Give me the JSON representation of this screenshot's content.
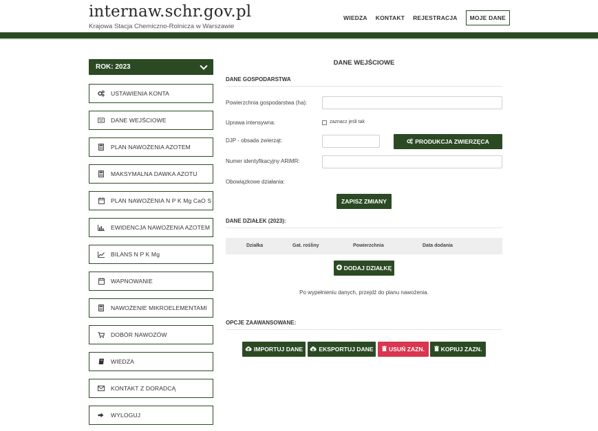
{
  "header": {
    "site_title": "internaw.schr.gov.pl",
    "site_subtitle": "Krajowa Stacja Chemiczno-Rolnicza w Warszawie",
    "nav": [
      "WIEDZA",
      "KONTAKT",
      "REJESTRACJA",
      "MOJE DANE"
    ]
  },
  "sidebar": {
    "year_label": "ROK: 2023",
    "items": [
      {
        "label": "USTAWIENIA KONTA",
        "icon": "cogs-icon"
      },
      {
        "label": "DANE WEJŚCIOWE",
        "icon": "keyboard-icon"
      },
      {
        "label": "PLAN NAWOŻENIA AZOTEM",
        "icon": "calculator-icon"
      },
      {
        "label": "MAKSYMALNA DAWKA AZOTU",
        "icon": "calculator-icon"
      },
      {
        "label": "PLAN NAWOŻENIA N P K Mg CaO S",
        "icon": "calendar-icon"
      },
      {
        "label": "EWIDENCJA NAWOŻENIA AZOTEM",
        "icon": "bar-chart-icon"
      },
      {
        "label": "BILANS N P K Mg",
        "icon": "line-chart-icon"
      },
      {
        "label": "WAPNOWANIE",
        "icon": "calendar-icon"
      },
      {
        "label": "NAWOŻENIE MIKROELEMENTAMI",
        "icon": "calculator-icon"
      },
      {
        "label": "DOBÓR NAWOZÓW",
        "icon": "cart-icon"
      },
      {
        "label": "WIEDZA",
        "icon": "book-icon"
      },
      {
        "label": "KONTAKT Z DORADCĄ",
        "icon": "envelope-icon"
      },
      {
        "label": "WYLOGUJ",
        "icon": "sign-out-icon"
      }
    ]
  },
  "main": {
    "title": "DANE WEJŚCIOWE",
    "farm_section": {
      "title": "DANE GOSPODARSTWA",
      "area_label": "Powierzchnia gospodarstwa (ha):",
      "area_value": "",
      "intensive_label": "Uprawa intensywna:",
      "intensive_checkbox_label": "zaznacz jeśli tak",
      "djp_label": "DJP - obsada zwierząt:",
      "djp_value": "",
      "animal_production_button": "PRODUKCJA ZWIERZĘCA",
      "arimr_label": "Numer identyfikacyjny ARiMR:",
      "arimr_value": "",
      "obligations_label": "Obowiązkowe działania:",
      "save_button": "ZAPISZ ZMIANY"
    },
    "plots_section": {
      "title": "DANE DZIAŁEK (2023):",
      "columns": [
        "Działka",
        "Gat. rośliny",
        "Powierzchnia",
        "Data dodania"
      ],
      "add_button": "DODAJ DZIAŁKĘ",
      "note": "Po wypełnieniu danych, przejdź do planu nawożenia."
    },
    "advanced_section": {
      "title": "OPCJE ZAAWANSOWANE:",
      "buttons": [
        "IMPORTUJ DANE",
        "EKSPORTUJ DANE",
        "USUŃ ZAZN.",
        "KOPIUJ ZAZN."
      ]
    }
  },
  "colors": {
    "brand_green": "#2b4a24",
    "danger_red": "#d9364f"
  }
}
